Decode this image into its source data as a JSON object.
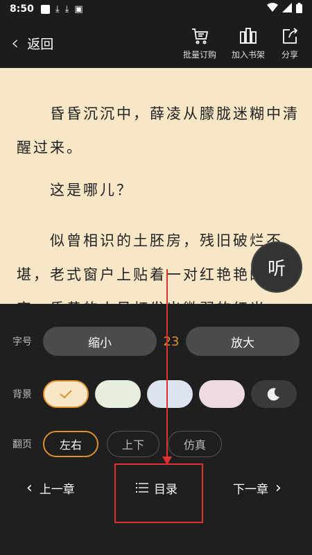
{
  "status": {
    "time": "8:50"
  },
  "header": {
    "back_label": "返回",
    "actions": [
      {
        "label": "批量订购",
        "icon": "cart-icon"
      },
      {
        "label": "加入书架",
        "icon": "bookshelf-icon"
      },
      {
        "label": "分享",
        "icon": "share-icon"
      }
    ]
  },
  "reader": {
    "paragraphs": [
      "　　昏昏沉沉中，薛凌从朦胧迷糊中清醒过来。",
      "　　这是哪儿？",
      "　　似曾相识的土胚房，残旧破烂不堪，老式窗户上贴着一对红艳艳的喜字，昏黄的小吊灯发出微弱的红光"
    ],
    "listen_label": "听"
  },
  "settings": {
    "font_row_label": "字号",
    "shrink_label": "缩小",
    "font_size": "23",
    "enlarge_label": "放大",
    "bg_row_label": "背景",
    "backgrounds": [
      "#f7e7c6",
      "#e6efdf",
      "#dde4ef",
      "#efd9e0",
      "#3a3a3a"
    ],
    "page_row_label": "翻页",
    "page_modes": [
      "左右",
      "上下",
      "仿真"
    ]
  },
  "nav": {
    "prev_label": "上一章",
    "toc_label": "目录",
    "next_label": "下一章"
  },
  "colors": {
    "accent": "#e08f2c",
    "annotation": "#e03030"
  }
}
